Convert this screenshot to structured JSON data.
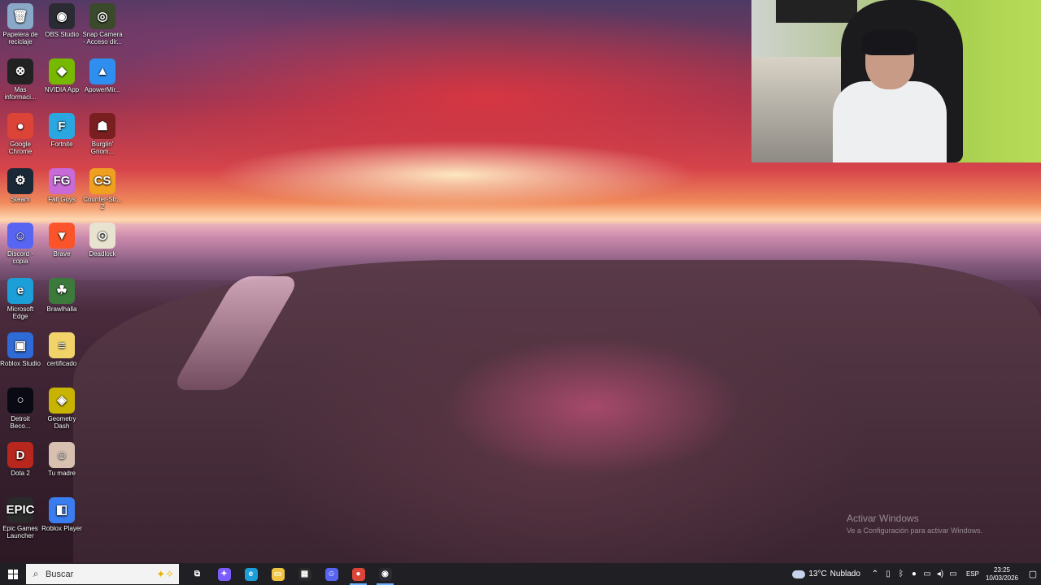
{
  "desktop": {
    "icons": [
      {
        "label": "Papelera de reciclaje",
        "glyph": "🗑",
        "color": "#8aa8c8",
        "icon": "recycle-bin-icon"
      },
      {
        "label": "OBS Studio",
        "glyph": "◉",
        "color": "#2b2b33",
        "icon": "obs-icon"
      },
      {
        "label": "Snap Camera - Acceso dir...",
        "glyph": "◎",
        "color": "#3a4a2a",
        "icon": "snap-camera-icon"
      },
      {
        "label": "Mas informaci...",
        "glyph": "⊗",
        "color": "#222",
        "icon": "info-icon"
      },
      {
        "label": "NVIDIA App",
        "glyph": "◆",
        "color": "#76b900",
        "icon": "nvidia-icon"
      },
      {
        "label": "ApowerMir...",
        "glyph": "▲",
        "color": "#2f8ff0",
        "icon": "apowermirror-icon"
      },
      {
        "label": "Google Chrome",
        "glyph": "●",
        "color": "#db4437",
        "icon": "chrome-icon"
      },
      {
        "label": "Fortnite",
        "glyph": "F",
        "color": "#2aa7e0",
        "icon": "fortnite-icon"
      },
      {
        "label": "Burglin' Gnom...",
        "glyph": "☗",
        "color": "#7a1f1f",
        "icon": "burglin-gnomes-icon"
      },
      {
        "label": "Steam",
        "glyph": "⚙",
        "color": "#1b2838",
        "icon": "steam-icon"
      },
      {
        "label": "Fall Guys",
        "glyph": "FG",
        "color": "#c86bd8",
        "icon": "fall-guys-icon"
      },
      {
        "label": "Counter-Str... 2",
        "glyph": "CS",
        "color": "#f0a020",
        "icon": "counter-strike-icon"
      },
      {
        "label": "Discord - copia",
        "glyph": "☺",
        "color": "#5865f2",
        "icon": "discord-icon"
      },
      {
        "label": "Brave",
        "glyph": "▼",
        "color": "#fb542b",
        "icon": "brave-icon"
      },
      {
        "label": "Deadlock",
        "glyph": "⊙",
        "color": "#e8e2d0",
        "icon": "deadlock-icon"
      },
      {
        "label": "Microsoft Edge",
        "glyph": "e",
        "color": "#1c9fd8",
        "icon": "edge-icon"
      },
      {
        "label": "Brawlhalla",
        "glyph": "☘",
        "color": "#3c7a3c",
        "icon": "brawlhalla-icon"
      },
      {
        "label": "Roblox Studio",
        "glyph": "▣",
        "color": "#2e6bd6",
        "icon": "roblox-studio-icon"
      },
      {
        "label": "certificado",
        "glyph": "≡",
        "color": "#f2d36a",
        "icon": "document-icon"
      },
      {
        "label": "Detroit Beco...",
        "glyph": "○",
        "color": "#0a0a14",
        "icon": "detroit-icon"
      },
      {
        "label": "Geometry Dash",
        "glyph": "◈",
        "color": "#c8b400",
        "icon": "geometry-dash-icon"
      },
      {
        "label": "Dota 2",
        "glyph": "D",
        "color": "#b8271d",
        "icon": "dota-icon"
      },
      {
        "label": "Tu madre",
        "glyph": "☺",
        "color": "#d8c0b0",
        "icon": "image-file-icon"
      },
      {
        "label": "Epic Games Launcher",
        "glyph": "EPIC",
        "color": "#2a2a2a",
        "icon": "epic-games-icon"
      },
      {
        "label": "Roblox Player",
        "glyph": "◧",
        "color": "#3a7df0",
        "icon": "roblox-player-icon"
      }
    ]
  },
  "watermark": {
    "title": "Activar Windows",
    "subtitle": "Ve a Configuración para activar Windows."
  },
  "taskbar": {
    "search_placeholder": "Buscar",
    "apps": [
      {
        "name": "task-view",
        "glyph": "⧉",
        "bg": "transparent",
        "active": false
      },
      {
        "name": "copilot",
        "glyph": "✦",
        "bg": "#7b5cff",
        "active": false
      },
      {
        "name": "edge",
        "glyph": "e",
        "bg": "#1c9fd8",
        "active": false
      },
      {
        "name": "file-explorer",
        "glyph": "▭",
        "bg": "#f2c443",
        "active": false
      },
      {
        "name": "store",
        "glyph": "▦",
        "bg": "#2a2a2a",
        "active": false
      },
      {
        "name": "discord",
        "glyph": "☺",
        "bg": "#5865f2",
        "active": false
      },
      {
        "name": "chrome",
        "glyph": "●",
        "bg": "#db4437",
        "active": true
      },
      {
        "name": "obs",
        "glyph": "◉",
        "bg": "#2b2b33",
        "active": true
      }
    ],
    "weather": {
      "temp": "13°C",
      "condition": "Nublado"
    },
    "language": "ESP",
    "time": "23:25",
    "date": "10/03/2026"
  }
}
